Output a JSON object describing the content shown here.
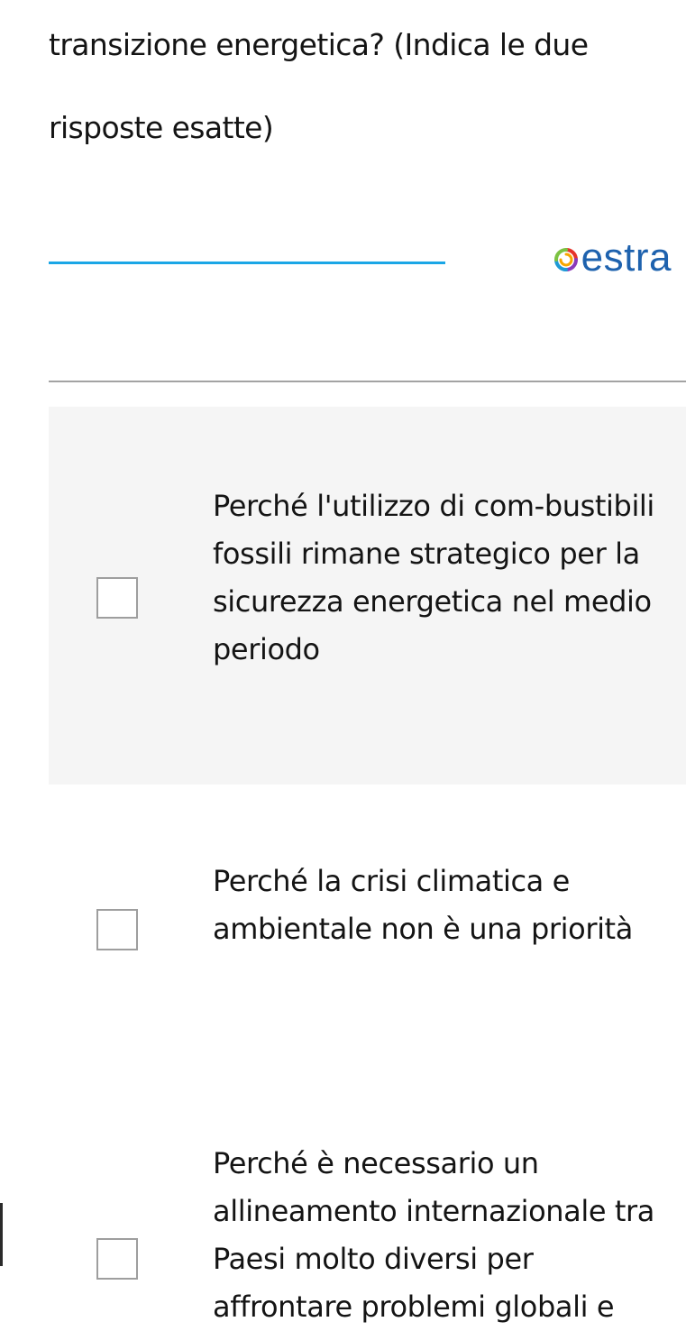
{
  "question": {
    "text": "transizione energetica? (Indica le due risposte esatte)"
  },
  "brand": {
    "name": "estra",
    "icon": "estra-swirl-logo",
    "line_color": "#1aa6e6",
    "text_color": "#1e62ae"
  },
  "options": [
    {
      "label": "Perché l'utilizzo di com-bustibili fossili rimane strategico per la sicurezza energetica nel medio periodo",
      "checked": false,
      "highlighted": true
    },
    {
      "label": "Perché la crisi climatica e ambientale non è una priorità",
      "checked": false,
      "highlighted": false
    },
    {
      "label": "Perché è necessario un allineamento internazionale tra Paesi molto diversi per affrontare problemi globali e",
      "checked": false,
      "highlighted": false
    }
  ]
}
